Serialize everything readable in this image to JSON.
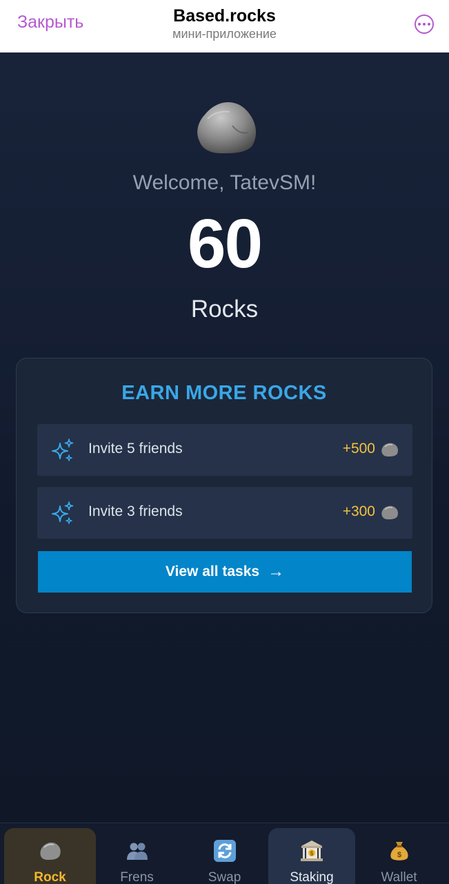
{
  "header": {
    "close_label": "Закрыть",
    "title": "Based.rocks",
    "subtitle": "мини-приложение",
    "more_icon": "more-horizontal-icon"
  },
  "hero": {
    "welcome": "Welcome, TatevSM!",
    "balance": "60",
    "unit": "Rocks"
  },
  "earn": {
    "title": "EARN MORE ROCKS",
    "tasks": [
      {
        "label": "Invite 5 friends",
        "reward": "+500",
        "icon": "sparkles-icon"
      },
      {
        "label": "Invite 3 friends",
        "reward": "+300",
        "icon": "sparkles-icon"
      }
    ],
    "view_all_label": "View all tasks",
    "view_all_arrow": "→"
  },
  "nav": {
    "items": [
      {
        "label": "Rock",
        "icon": "rock-icon",
        "active": true
      },
      {
        "label": "Frens",
        "icon": "people-icon",
        "active": false
      },
      {
        "label": "Swap",
        "icon": "swap-icon",
        "active": false
      },
      {
        "label": "Staking",
        "icon": "bank-icon",
        "active": false
      },
      {
        "label": "Wallet",
        "icon": "money-bag-icon",
        "active": false
      }
    ]
  },
  "colors": {
    "accent_purple": "#b45ad0",
    "accent_blue": "#3aa7e6",
    "button_blue": "#0385c9",
    "reward_gold": "#f4c23c",
    "background": "#121b2e"
  }
}
